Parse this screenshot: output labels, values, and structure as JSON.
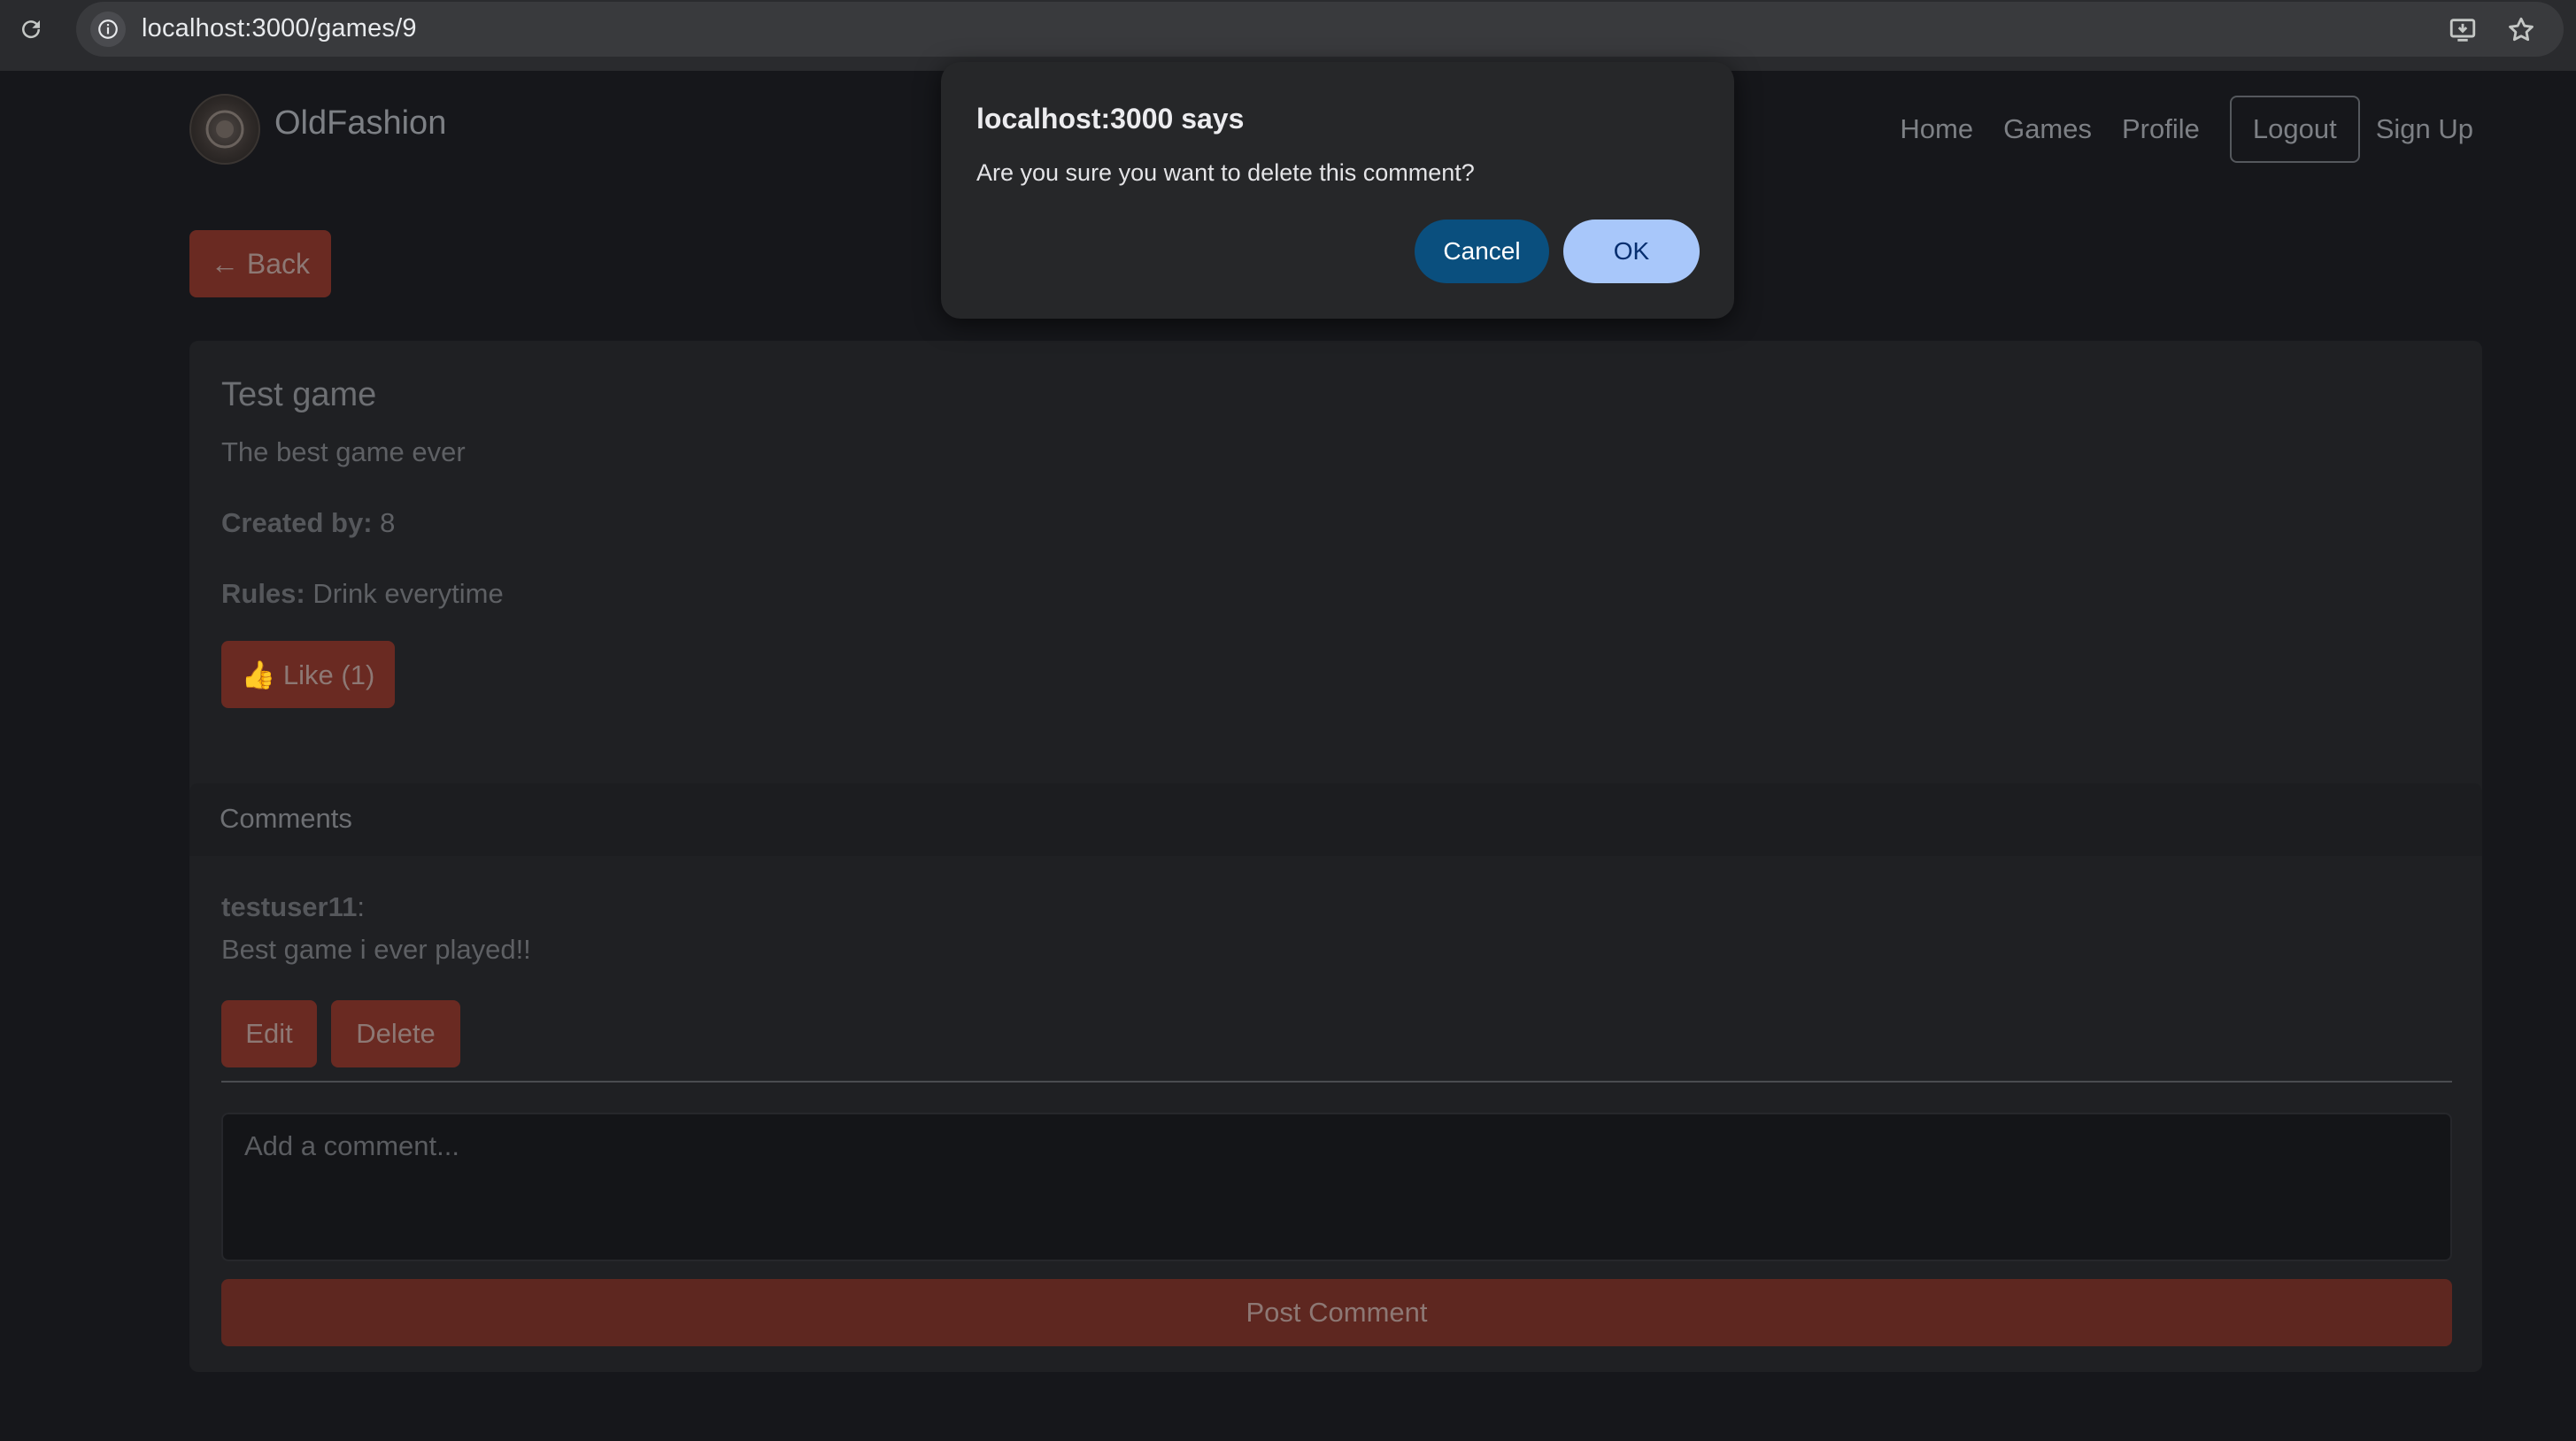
{
  "browser": {
    "url": "localhost:3000/games/9",
    "icons": [
      "reload-icon",
      "site-info-icon",
      "install-app-icon",
      "bookmark-star-icon"
    ]
  },
  "nav": {
    "brand": "OldFashion",
    "links": [
      "Home",
      "Games",
      "Profile"
    ],
    "logout_label": "Logout",
    "signup_label": "Sign Up"
  },
  "back_label": "← Back",
  "game": {
    "title": "Test game",
    "description": "The best game ever",
    "created_by_label": "Created by:",
    "created_by_value": "8",
    "rules_label": "Rules:",
    "rules_value": "Drink everytime",
    "like_label": "👍 Like (1)"
  },
  "comments": {
    "header": "Comments",
    "items": [
      {
        "user": "testuser11",
        "separator": ":",
        "text": "Best game i ever played!!",
        "edit_label": "Edit",
        "delete_label": "Delete"
      }
    ],
    "input_placeholder": "Add a comment...",
    "post_label": "Post Comment"
  },
  "dialog": {
    "title": "localhost:3000 says",
    "message": "Are you sure you want to delete this comment?",
    "cancel_label": "Cancel",
    "ok_label": "OK"
  },
  "colors": {
    "accent_button": "#6a2a22",
    "dialog_ok": "#a8c7fa",
    "dialog_cancel": "#0a4f7e",
    "page_background": "#16171b"
  }
}
